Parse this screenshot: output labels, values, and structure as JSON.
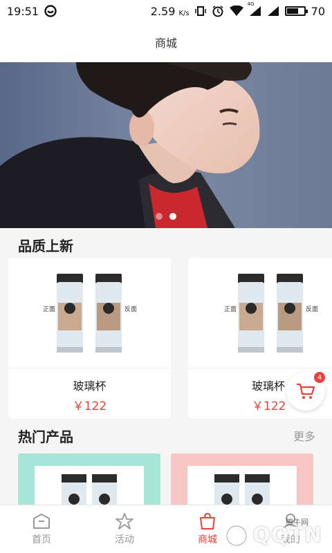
{
  "status_bar": {
    "time": "19:51",
    "network_speed": "2.59",
    "network_unit": "K/s",
    "network_type": "4G",
    "battery_level": "70"
  },
  "header": {
    "title": "商城"
  },
  "banner": {
    "slide_count": 2,
    "active_slide": 2
  },
  "new_section": {
    "title": "品质上新",
    "products": [
      {
        "name": "玻璃杯",
        "price": "￥122",
        "cup_left_label": "正面",
        "cup_right_label": "反面"
      },
      {
        "name": "玻璃杯",
        "price": "￥122",
        "cup_left_label": "正面",
        "cup_right_label": "反面"
      }
    ]
  },
  "hot_section": {
    "title": "热门产品",
    "more_label": "更多"
  },
  "float_cart": {
    "badge_count": "4"
  },
  "bottom_nav": {
    "items": [
      {
        "label": "首页",
        "icon": "home-icon"
      },
      {
        "label": "活动",
        "icon": "star-icon"
      },
      {
        "label": "商城",
        "icon": "shop-bag-icon"
      },
      {
        "label": "我的",
        "icon": "user-icon"
      }
    ],
    "active_index": 2
  },
  "watermark": {
    "logo_text": "QQTN",
    "small_text": "腾牛网"
  },
  "colors": {
    "accent": "#e8413a",
    "mint": "#a8e6d8",
    "pink": "#f7c6c4"
  }
}
